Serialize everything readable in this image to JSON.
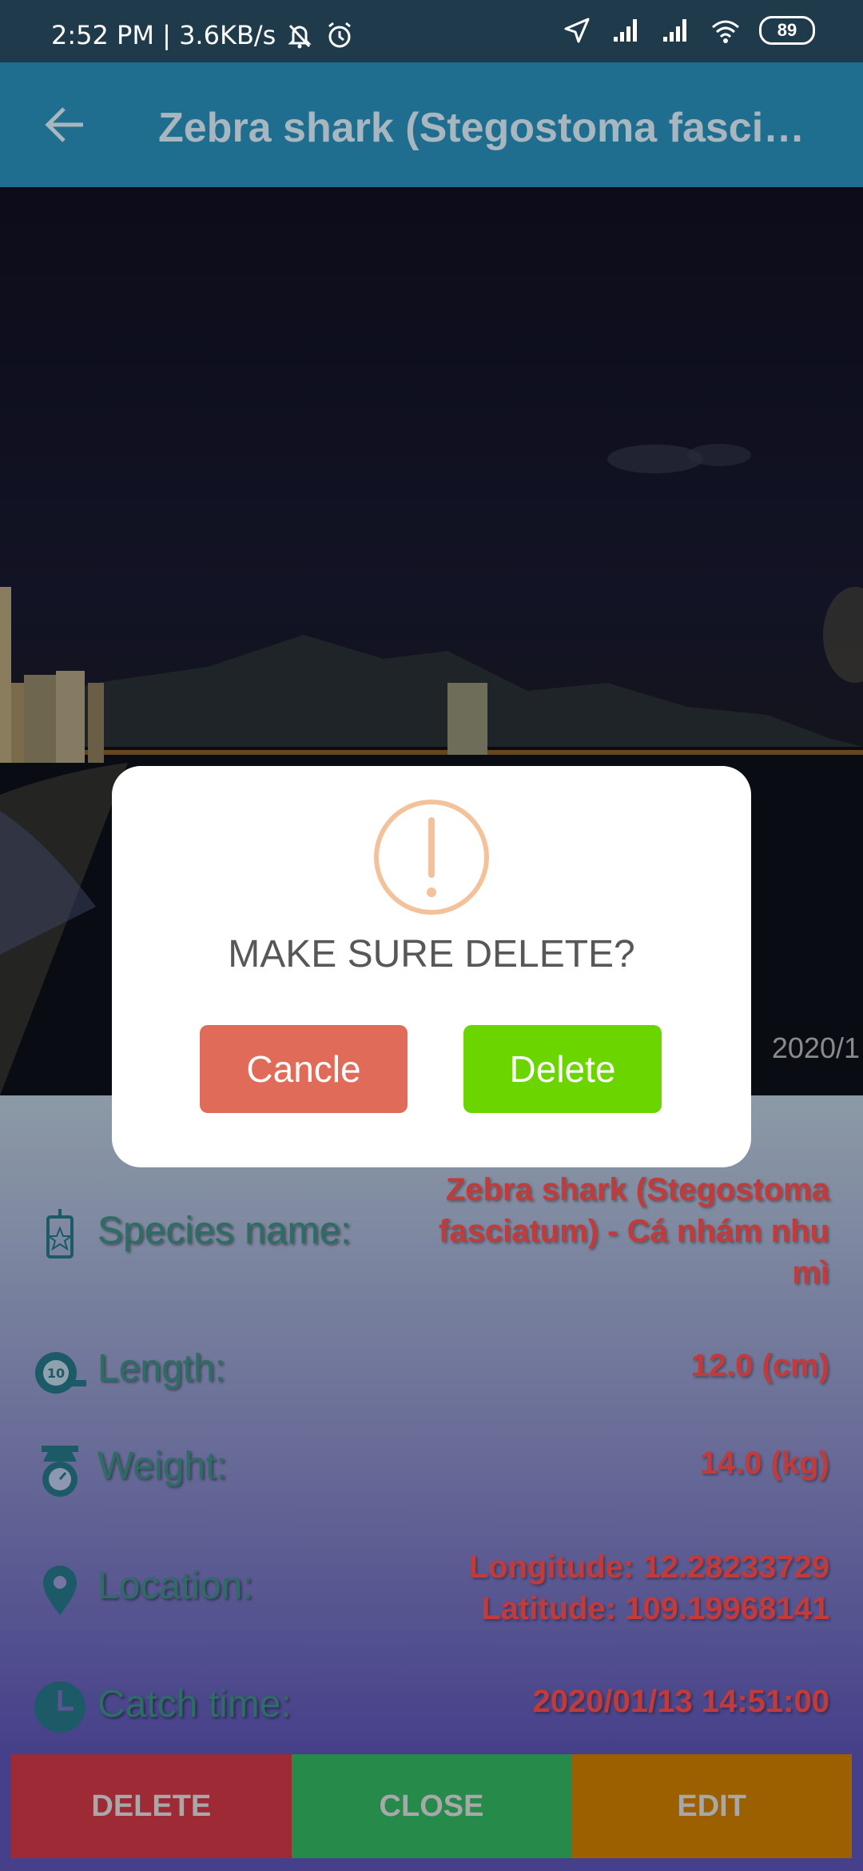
{
  "status_bar": {
    "time_speed": "2:52 PM | 3.6KB/s",
    "battery": "89"
  },
  "app_bar": {
    "title": "Zebra shark (Stegostoma fasci…"
  },
  "photo": {
    "timestamp": "2020/1"
  },
  "details": {
    "species": {
      "label": "Species name:",
      "value_lines": [
        "Zebra shark (Stegostoma",
        "fasciatum) - Cá nhám nhu",
        "mì"
      ]
    },
    "length": {
      "label": "Length:",
      "value": "12.0 (cm)",
      "icon_text": "10"
    },
    "weight": {
      "label": "Weight:",
      "value": "14.0 (kg)"
    },
    "location": {
      "label": "Location:",
      "longitude": "Longitude: 12.28233729",
      "latitude": "Latitude: 109.19968141"
    },
    "catch_time": {
      "label": "Catch time:",
      "value": "2020/01/13 14:51:00"
    }
  },
  "bottom_buttons": {
    "delete": "DELETE",
    "close": "CLOSE",
    "edit": "EDIT"
  },
  "dialog": {
    "message": "MAKE SURE DELETE?",
    "cancel": "Cancle",
    "delete": "Delete"
  },
  "colors": {
    "app_bar": "#1f6e8f",
    "label": "#2c6e63",
    "value": "#c23a3a",
    "warn": "#f3c29a"
  }
}
